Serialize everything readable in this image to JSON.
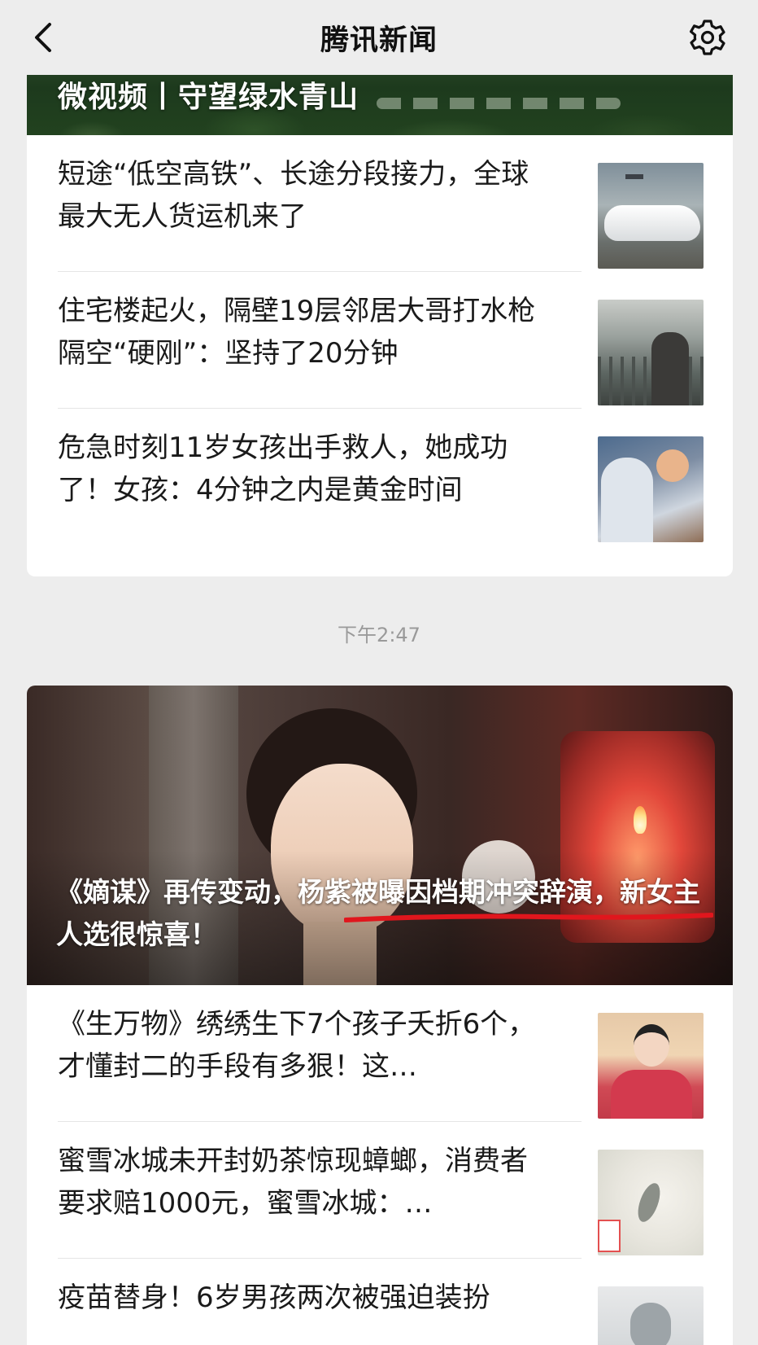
{
  "header": {
    "title": "腾讯新闻",
    "back_icon": "chevron-left-icon",
    "settings_icon": "gear-icon"
  },
  "card_1": {
    "hero_title": "微视频丨守望绿水青山",
    "items": [
      {
        "title": "短途“低空高铁”、长途分段接力，全球最大无人货运机来了",
        "thumb_icon": "cargo-drone-photo"
      },
      {
        "title": "住宅楼起火，隔壁19层邻居大哥打水枪隔空“硬刚”：坚持了20分钟",
        "thumb_icon": "fire-hose-photo"
      },
      {
        "title": "危急时刻11岁女孩出手救人，她成功了！女孩：4分钟之内是黄金时间",
        "thumb_icon": "rescue-photo"
      }
    ]
  },
  "timestamp": "下午2:47",
  "card_2": {
    "hero_title": "《嫡谋》再传变动，杨紫被曝因档期冲突辞演，新女主人选很惊喜！",
    "underline_color": "#e0161d",
    "items": [
      {
        "title": "《生万物》绣绣生下7个孩子夭折6个，才懂封二的手段有多狠！这…",
        "thumb_icon": "drama-photo"
      },
      {
        "title": "蜜雪冰城未开封奶茶惊现蟑螂，消费者要求赔1000元，蜜雪冰城：…",
        "thumb_icon": "milk-tea-photo"
      },
      {
        "title": "疫苗替身！6岁男孩两次被强迫装扮",
        "thumb_icon": "vaccine-photo"
      }
    ]
  },
  "colors": {
    "background": "#ededed",
    "card": "#ffffff",
    "text": "#1a1a1a",
    "timestamp": "#9a9a9a"
  }
}
